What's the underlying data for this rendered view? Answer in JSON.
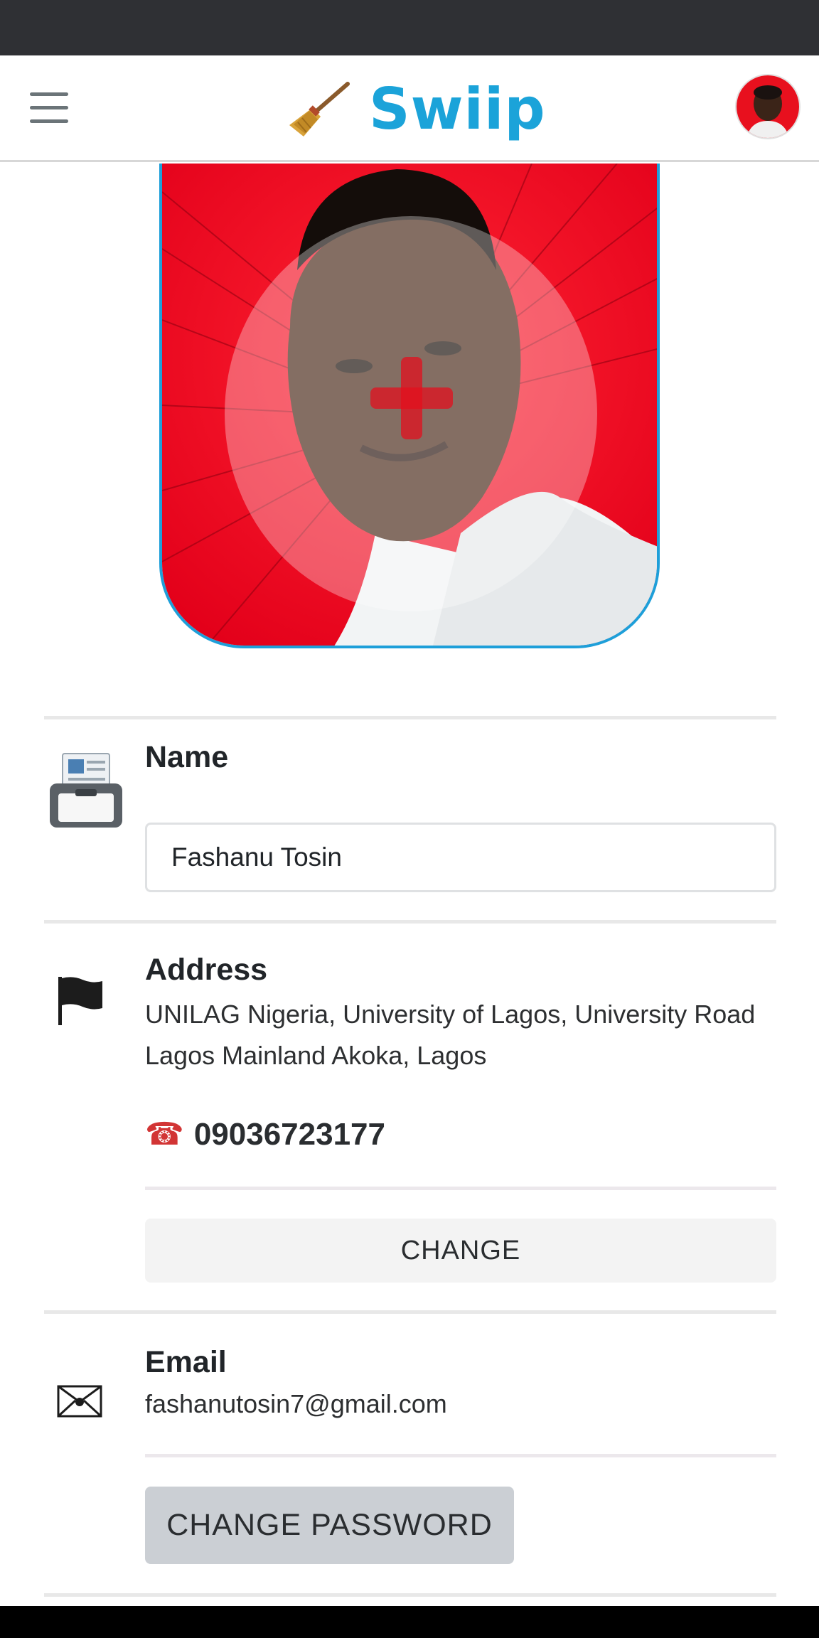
{
  "app": {
    "brand_name": "Swiip",
    "brand_color": "#1ba3d9"
  },
  "nav": {
    "menu_icon": "hamburger-menu-icon",
    "logo_icon": "broom-icon",
    "avatar_icon": "user-avatar"
  },
  "profile": {
    "photo_icon": "profile-photo",
    "add_photo_icon": "plus-icon"
  },
  "name_section": {
    "icon": "printer-icon",
    "label": "Name",
    "value": "Fashanu Tosin"
  },
  "address_section": {
    "icon": "black-flag-icon",
    "label": "Address",
    "value": "UNILAG Nigeria, University of Lagos, University Road Lagos Mainland Akoka, Lagos",
    "phone_icon": "telephone-icon",
    "phone": "09036723177",
    "change_button": "CHANGE"
  },
  "email_section": {
    "icon": "envelope-icon",
    "label": "Email",
    "value": "fashanutosin7@gmail.com",
    "change_password_button": "CHANGE PASSWORD"
  }
}
